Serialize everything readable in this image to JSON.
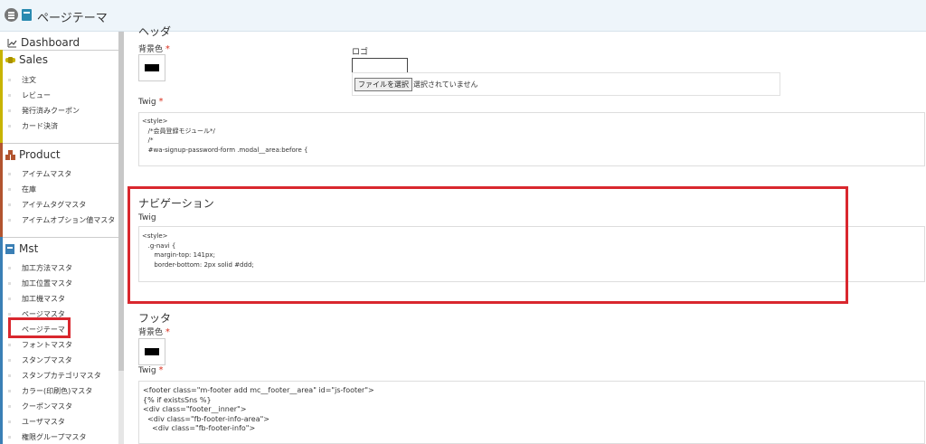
{
  "header": {
    "title": "ページテーマ"
  },
  "sidebar": {
    "dashboard": "Dashboard",
    "sales": {
      "label": "Sales",
      "items": [
        "注文",
        "レビュー",
        "発行済みクーポン",
        "カード決済"
      ]
    },
    "product": {
      "label": "Product",
      "items": [
        "アイテムマスタ",
        "在庫",
        "アイテムタグマスタ",
        "アイテムオプション値マスタ"
      ]
    },
    "mst": {
      "label": "Mst",
      "items": [
        "加工方法マスタ",
        "加工位置マスタ",
        "加工機マスタ",
        "ページマスタ",
        "ページテーマ",
        "フォントマスタ",
        "スタンプマスタ",
        "スタンプカテゴリマスタ",
        "カラー(印刷色)マスタ",
        "クーポンマスタ",
        "ユーザマスタ",
        "権限グループマスタ"
      ]
    },
    "colors": {
      "sales": "#c8b400",
      "product": "#b2542f",
      "mst": "#3a7fb5"
    }
  },
  "header_section": {
    "title": "ヘッダ",
    "bg_label": "背景色",
    "logo_label": "ロゴ",
    "file_button": "ファイルを選択",
    "file_status": "選択されていません",
    "twig_label": "Twig",
    "code": [
      "<style>",
      "",
      "   /*会員登録モジュール*/",
      "   /*",
      "   #wa-signup-password-form .modal__area:before {"
    ]
  },
  "nav_section": {
    "title": "ナビゲーション",
    "twig_label": "Twig",
    "code": [
      "<style>",
      "",
      "   .g-navi {",
      "      margin-top: 141px;",
      "      border-bottom: 2px solid #ddd;"
    ]
  },
  "footer_section": {
    "title": "フッタ",
    "bg_label": "背景色",
    "twig_label": "Twig",
    "code": [
      "<footer class=\"m-footer add mc__footer__area\" id=\"js-footer\">",
      "{% if existsSns %}",
      "<div class=\"footer__inner\">",
      "  <div class=\"fb-footer-info-area\">",
      "    <div class=\"fb-footer-info\">"
    ]
  },
  "required_mark": "*",
  "highlight_color": "#d9272e"
}
